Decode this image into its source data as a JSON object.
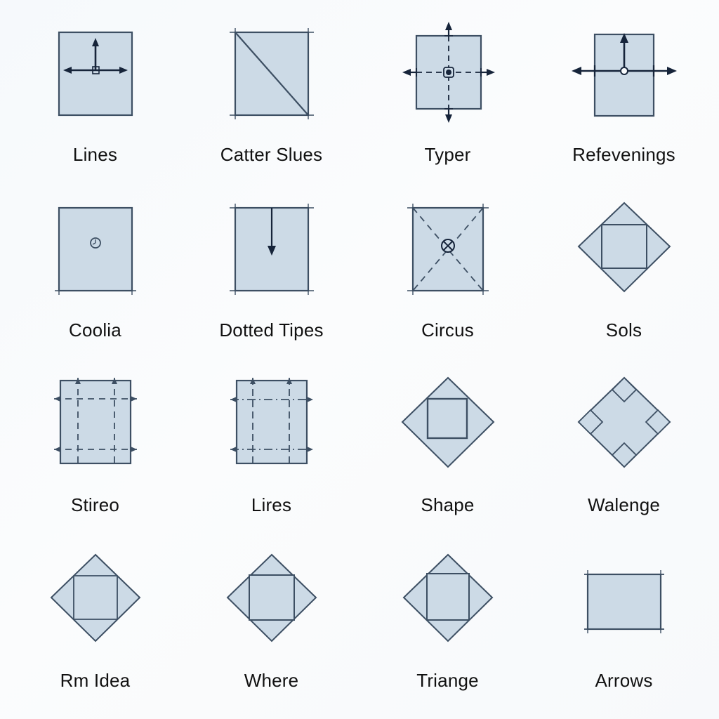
{
  "page": {
    "title": "Geometric Shape Icon Grid",
    "background_color": "#f7fafc",
    "columns": 4,
    "rows": 4
  },
  "style_tokens": {
    "shape_fill": "#ccdae6",
    "shape_stroke": "#3d4f63",
    "annotation_color": "#1b2b3d",
    "label_color": "#111111",
    "label_font_size_px": 26
  },
  "cells": [
    {
      "index": 1,
      "row": 1,
      "column": 1,
      "label": "Lines",
      "icon_name": "square-with-up-and-horizontal-arrows-icon",
      "shape": "square",
      "annotations": [
        "up-arrow",
        "left-arrow",
        "right-arrow",
        "dashed-center-stub",
        "center-marker"
      ]
    },
    {
      "index": 2,
      "row": 1,
      "column": 2,
      "label": "Catter Slues",
      "icon_name": "square-with-diagonal-line-icon",
      "shape": "square",
      "annotations": [
        "diagonal-line-top-left-to-bottom-right",
        "corner-tick-marks"
      ]
    },
    {
      "index": 3,
      "row": 1,
      "column": 3,
      "label": "Typer",
      "icon_name": "square-with-crosshair-dashed-axes-icon",
      "shape": "square",
      "annotations": [
        "dashed-vertical-axis",
        "dashed-horizontal-axis",
        "four-outward-arrows",
        "center-dot-marker",
        "edge-tick-marks"
      ]
    },
    {
      "index": 4,
      "row": 1,
      "column": 4,
      "label": "Refevenings",
      "icon_name": "square-with-up-arrow-and-horizontal-axis-icon",
      "shape": "square",
      "annotations": [
        "up-arrow",
        "horizontal-double-arrow",
        "center-circle-marker",
        "edge-tick-marks"
      ]
    },
    {
      "index": 5,
      "row": 2,
      "column": 1,
      "label": "Coolia",
      "icon_name": "square-with-small-clock-marker-icon",
      "shape": "square",
      "annotations": [
        "center-small-circle-marker",
        "bottom-corner-ticks"
      ]
    },
    {
      "index": 6,
      "row": 2,
      "column": 2,
      "label": "Dotted Tipes",
      "icon_name": "square-with-down-arrow-icon",
      "shape": "square",
      "annotations": [
        "down-arrow-from-top-edge",
        "corner-tick-marks"
      ]
    },
    {
      "index": 7,
      "row": 2,
      "column": 3,
      "label": "Circus",
      "icon_name": "square-with-dashed-diagonals-icon",
      "shape": "square",
      "annotations": [
        "dashed-diagonal-both",
        "center-crossed-marker",
        "corner-tick-marks"
      ]
    },
    {
      "index": 8,
      "row": 2,
      "column": 4,
      "label": "Sols",
      "icon_name": "diamond-with-inscribed-square-icon",
      "shape": "diamond",
      "annotations": [
        "inner-square-inscribed",
        "four-corner-triangles"
      ]
    },
    {
      "index": 9,
      "row": 3,
      "column": 1,
      "label": "Stireo",
      "icon_name": "square-with-dashed-inset-guides-icon",
      "shape": "square",
      "annotations": [
        "dashed-vertical-guides",
        "dashed-horizontal-guides",
        "small-corner-arrows"
      ]
    },
    {
      "index": 10,
      "row": 3,
      "column": 2,
      "label": "Lires",
      "icon_name": "square-with-dash-dot-inset-guides-icon",
      "shape": "square",
      "annotations": [
        "dash-dot-vertical-guides",
        "dash-dot-horizontal-guides",
        "small-corner-arrows"
      ]
    },
    {
      "index": 11,
      "row": 3,
      "column": 3,
      "label": "Shape",
      "icon_name": "diamond-with-centered-square-icon",
      "shape": "diamond",
      "annotations": [
        "centered-upright-square-outline"
      ]
    },
    {
      "index": 12,
      "row": 3,
      "column": 4,
      "label": "Walenge",
      "icon_name": "diamond-with-four-corner-notches-icon",
      "shape": "diamond",
      "annotations": [
        "four-small-diamond-notches-at-vertices"
      ]
    },
    {
      "index": 13,
      "row": 4,
      "column": 1,
      "label": "Rm Idea",
      "icon_name": "diamond-with-octagonal-inner-shape-icon",
      "shape": "diamond",
      "annotations": [
        "inner-octagon-edges",
        "four-corner-triangles"
      ]
    },
    {
      "index": 14,
      "row": 4,
      "column": 2,
      "label": "Where",
      "icon_name": "diamond-with-inscribed-square-variant-icon",
      "shape": "diamond",
      "annotations": [
        "inner-square-inscribed",
        "four-corner-triangles"
      ]
    },
    {
      "index": 15,
      "row": 4,
      "column": 3,
      "label": "Triange",
      "icon_name": "diamond-with-inscribed-square-triangles-icon",
      "shape": "diamond",
      "annotations": [
        "inner-square-inscribed",
        "four-corner-triangles"
      ]
    },
    {
      "index": 16,
      "row": 4,
      "column": 4,
      "label": "Arrows",
      "icon_name": "plain-rectangle-with-end-ticks-icon",
      "shape": "rectangle",
      "annotations": [
        "left-end-ticks",
        "right-end-ticks"
      ]
    }
  ]
}
